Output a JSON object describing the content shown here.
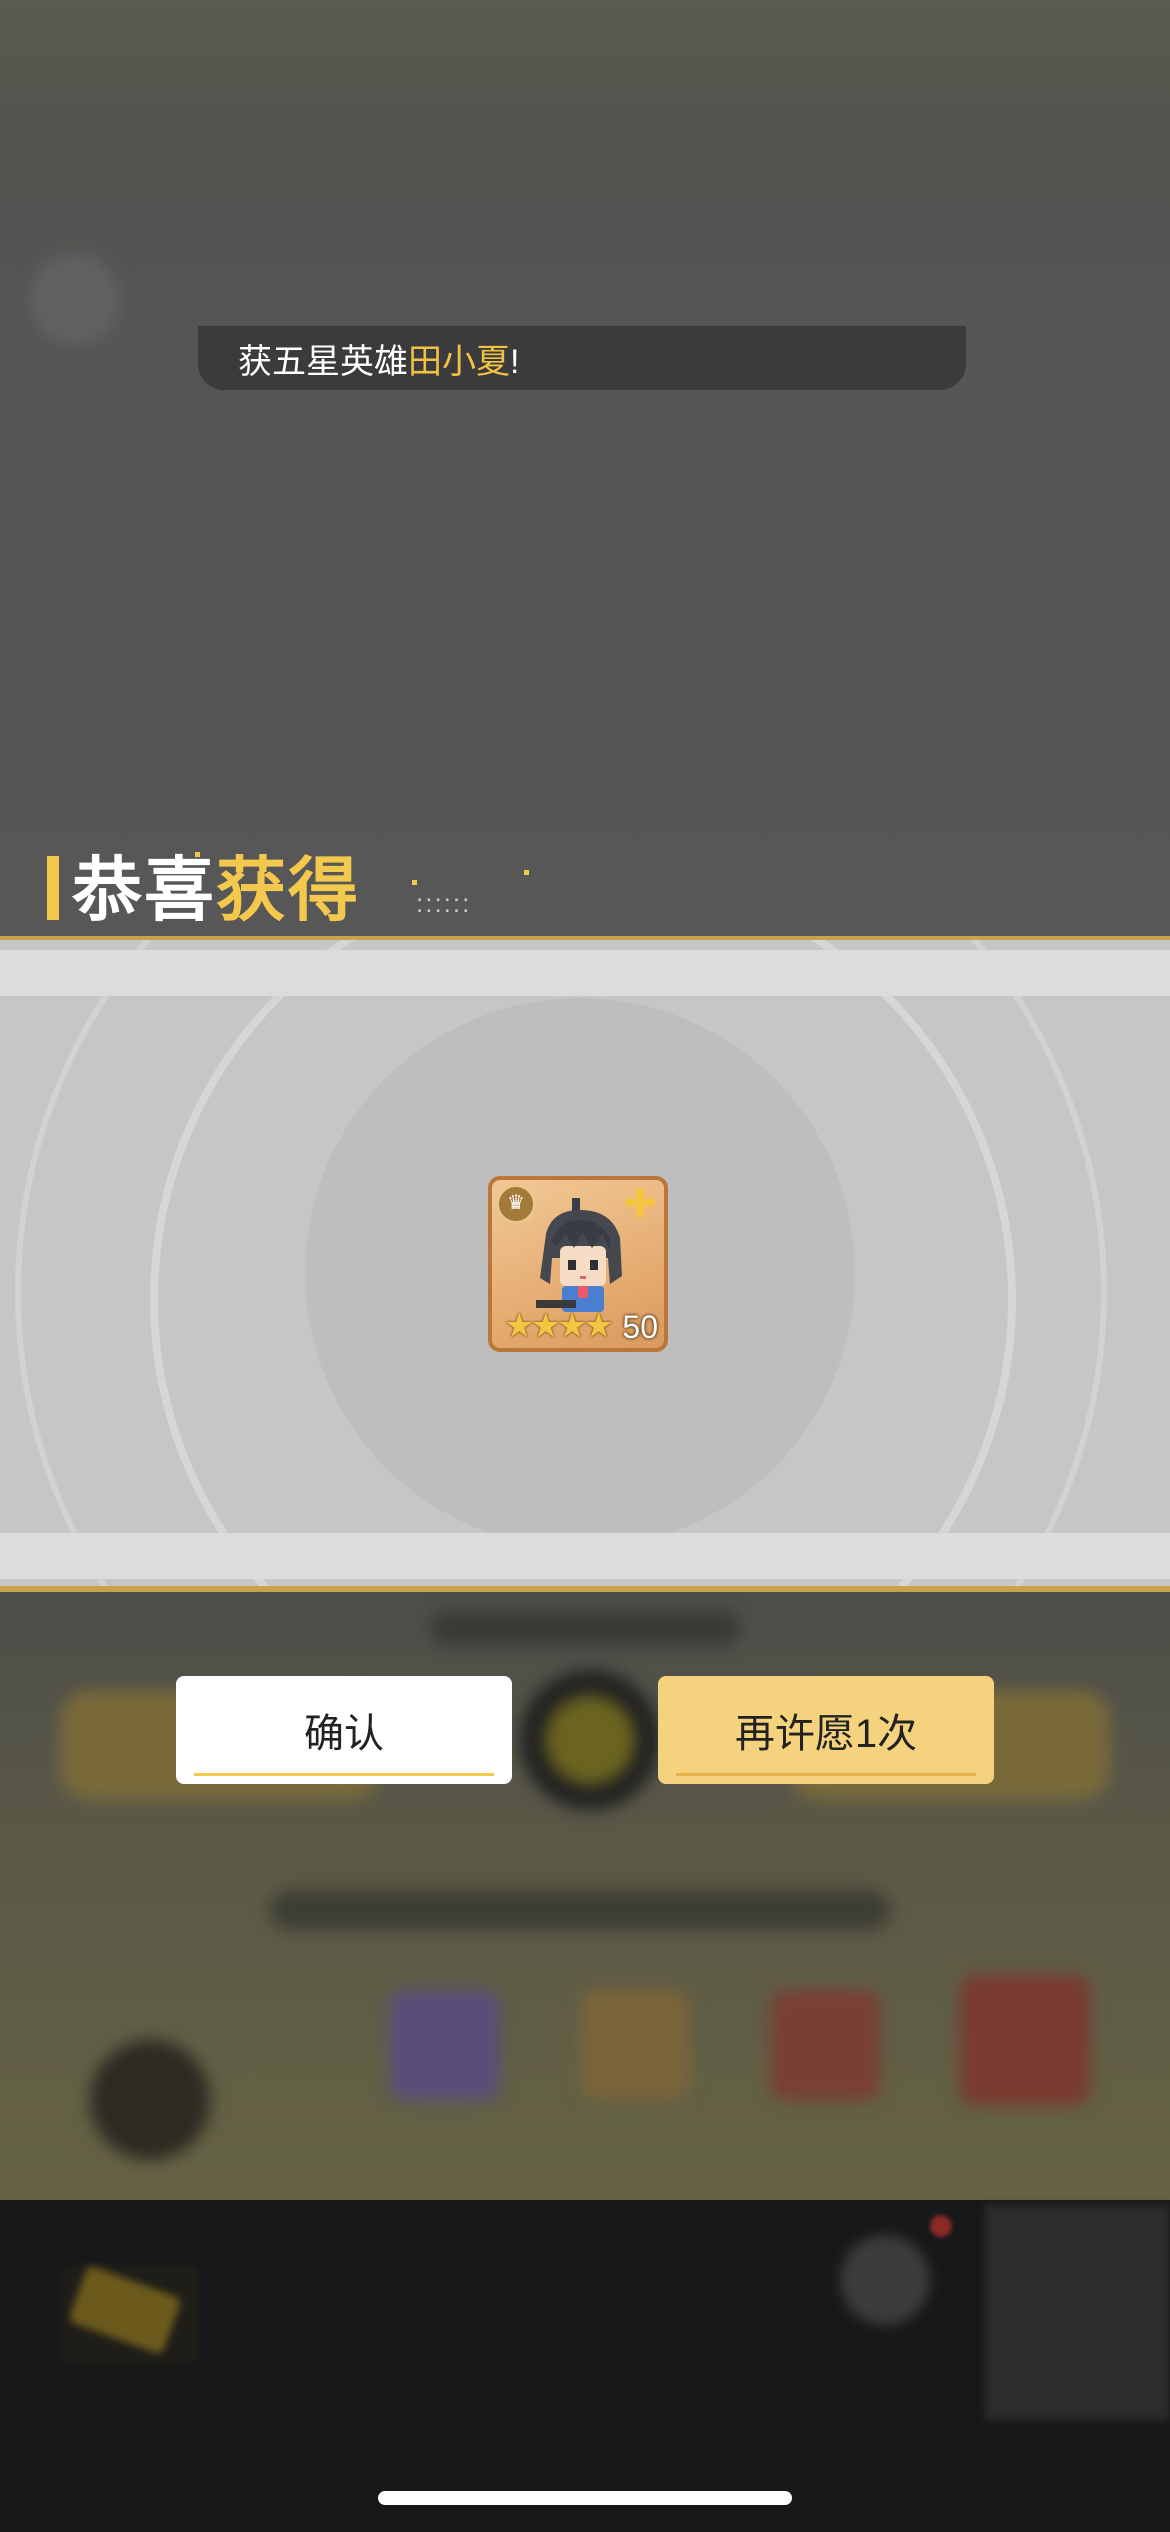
{
  "toast": {
    "prefix": "获五星英雄",
    "hero_name": "田小夏",
    "suffix": "!"
  },
  "title": {
    "part1": "恭喜",
    "part2": "获得",
    "dots": "::::::"
  },
  "reward": {
    "hero_level": "50",
    "stars": "★★★★",
    "star_count": 4
  },
  "buttons": {
    "confirm_label": "确认",
    "again_label": "再许愿1次"
  },
  "colors": {
    "accent": "#f2c94c",
    "confirm_bg": "#ffffff",
    "again_bg": "#f5d27d",
    "band_line": "#c9a24a"
  },
  "icons": [
    "crown-badge-icon",
    "puzzle-piece-icon",
    "star-icon"
  ]
}
